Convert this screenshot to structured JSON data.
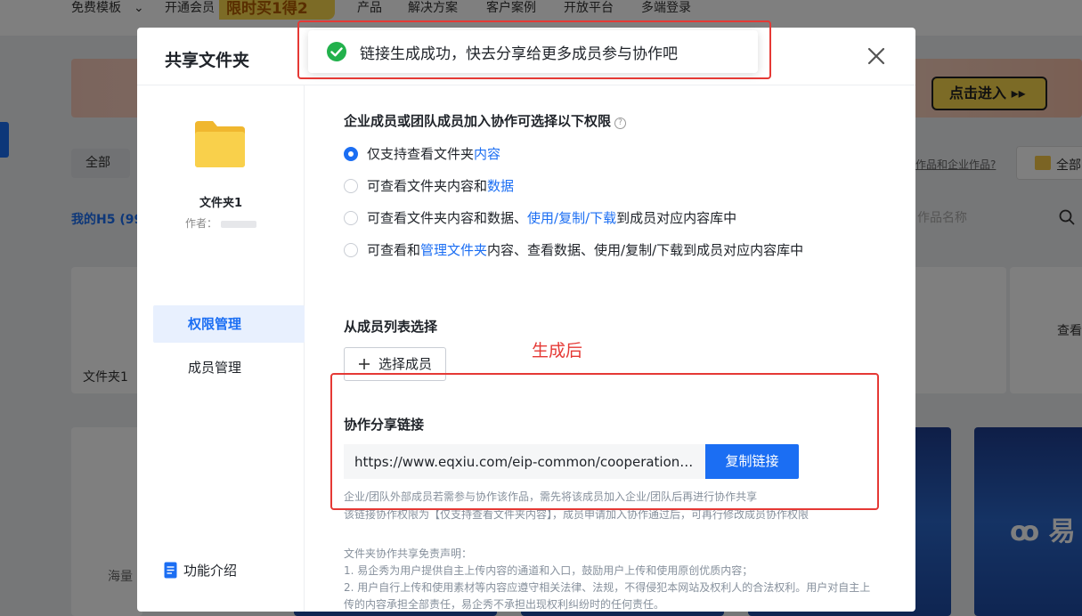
{
  "background": {
    "nav_items": [
      "免费模板",
      "开通会员",
      "产品",
      "解决方案",
      "客户案例",
      "开放平台",
      "多端登录"
    ],
    "promo_badge": "限时买1得2",
    "banner_button": "点击进入 ▸▸",
    "tab_all": "全部",
    "my_h5": "我的H5 (99",
    "link_text": "作品和企业作品?",
    "folder_filter": "全部",
    "search_placeholder": "作品名称",
    "card_folder_name": "文件夹1",
    "card_view": "查看",
    "card_poster": "海量",
    "card_brand": "ꝏ 易"
  },
  "modal": {
    "title": "共享文件夹",
    "folder_name": "文件夹1",
    "author_label": "作者：",
    "sidebar": {
      "items": [
        {
          "label": "权限管理",
          "active": true
        },
        {
          "label": "成员管理",
          "active": false
        }
      ],
      "feature_intro": "功能介绍"
    },
    "permissions": {
      "title": "企业成员或团队成员加入协作可选择以下权限",
      "help_icon": "?",
      "options": [
        {
          "pre": "仅支持查看文件夹",
          "hl": "内容",
          "post": "",
          "checked": true
        },
        {
          "pre": "可查看文件夹内容和",
          "hl": "数据",
          "post": "",
          "checked": false
        },
        {
          "pre": "可查看文件夹内容和数据、",
          "hl": "使用/复制/下载",
          "post": "到成员对应内容库中",
          "checked": false
        },
        {
          "pre": "可查看和",
          "hl": "管理文件夹",
          "post": "内容、查看数据、使用/复制/下载到成员对应内容库中",
          "checked": false
        }
      ]
    },
    "members": {
      "title": "从成员列表选择",
      "select_button": "选择成员"
    },
    "share": {
      "title": "协作分享链接",
      "link": "https://www.eqxiu.com/eip-common/cooperation…",
      "copy_button": "复制链接",
      "notes": [
        "企业/团队外部成员若需参与协作该作品，需先将该成员加入企业/团队后再进行协作共享",
        "该链接协作权限为【仅支持查看文件夹内容】，成员申请加入协作通过后，可再行修改成员协作权限"
      ]
    },
    "disclaimer": [
      "文件夹协作共享免责声明：",
      "1. 易企秀为用户提供自主上传内容的通道和入口，鼓励用户上传和使用原创优质内容；",
      "2. 用户自行上传和使用素材等内容应遵守相关法律、法规，不得侵犯本网站及权利人的合法权利。用户对自主上传的内容承担全部责任，易企秀不承担出现权利纠纷时的任何责任。"
    ]
  },
  "toast": {
    "message": "链接生成成功，快去分享给更多成员参与协作吧",
    "icon": "check-circle-icon"
  },
  "annotation": {
    "label": "生成后",
    "color": "#e53935"
  },
  "colors": {
    "primary": "#1b6ef3",
    "success": "#22b14c",
    "folder": "#f7c948"
  }
}
